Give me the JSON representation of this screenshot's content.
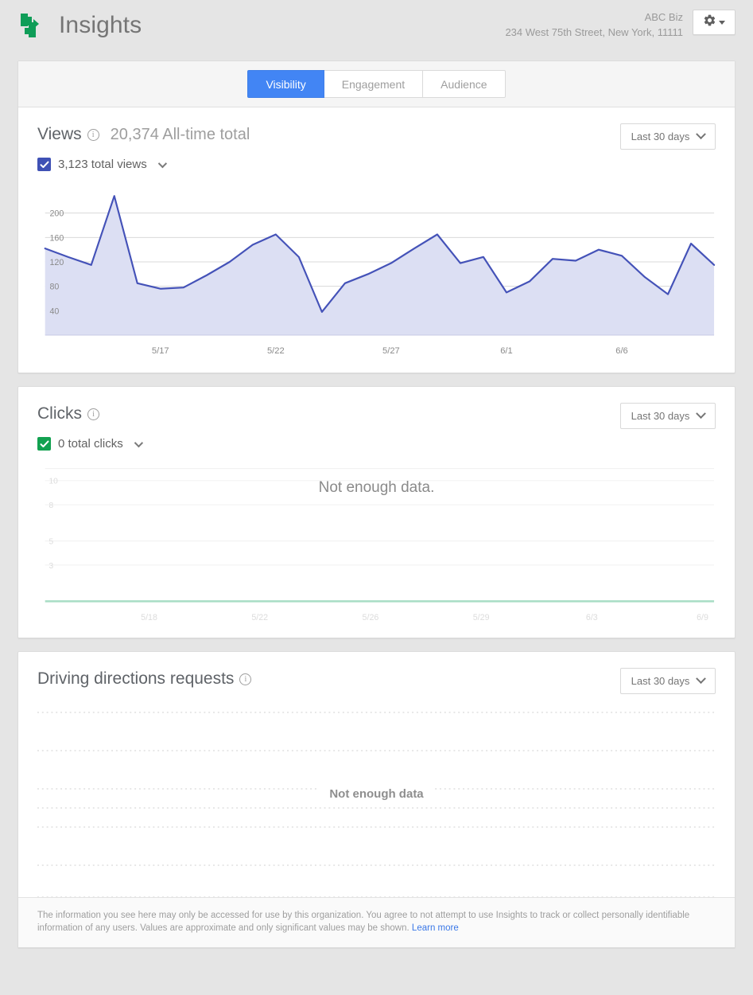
{
  "header": {
    "app_title": "Insights",
    "logo_icon": "insights-arrows-logo",
    "business_name": "ABC Biz",
    "business_address": "234 West 75th Street, New York, 11111",
    "settings_icon": "gear-icon"
  },
  "tabs": [
    {
      "label": "Visibility",
      "active": true
    },
    {
      "label": "Engagement",
      "active": false
    },
    {
      "label": "Audience",
      "active": false
    }
  ],
  "views": {
    "title": "Views",
    "info_icon": "info-icon",
    "subtitle": "20,374 All-time total",
    "range_label": "Last 30 days",
    "legend_label": "3,123 total views",
    "checkbox_color": "#3f51b5"
  },
  "clicks": {
    "title": "Clicks",
    "info_icon": "info-icon",
    "range_label": "Last 30 days",
    "legend_label": "0 total clicks",
    "checkbox_color": "#12a150",
    "empty_message": "Not enough data."
  },
  "driving": {
    "title": "Driving directions requests",
    "info_icon": "info-icon",
    "range_label": "Last 30 days",
    "empty_message": "Not enough data"
  },
  "footer": {
    "text": "The information you see here may only be accessed for use by this organization. You agree to not attempt to use Insights to track or collect personally identifiable information of any users. Values are approximate and only significant values may be shown.",
    "link_label": "Learn more"
  },
  "chart_data": [
    {
      "type": "area",
      "id": "views-chart",
      "title": "Views",
      "xlabel": "",
      "ylabel": "",
      "ylim": [
        0,
        240
      ],
      "yticks": [
        40,
        80,
        120,
        160,
        200
      ],
      "grid": true,
      "line_color": "#4452b8",
      "fill_color": "#dcdff3",
      "xtick_labels": [
        "5/17",
        "5/22",
        "5/27",
        "6/1",
        "6/6"
      ],
      "xtick_indices": [
        5,
        10,
        15,
        20,
        25
      ],
      "x": [
        "5/12",
        "5/13",
        "5/14",
        "5/15",
        "5/16",
        "5/17",
        "5/18",
        "5/19",
        "5/20",
        "5/21",
        "5/22",
        "5/23",
        "5/24",
        "5/25",
        "5/26",
        "5/27",
        "5/28",
        "5/29",
        "5/30",
        "5/31",
        "6/1",
        "6/2",
        "6/3",
        "6/4",
        "6/5",
        "6/6",
        "6/7",
        "6/8",
        "6/9",
        "6/10"
      ],
      "values": [
        142,
        128,
        115,
        228,
        85,
        76,
        78,
        98,
        120,
        148,
        165,
        128,
        38,
        85,
        100,
        118,
        142,
        165,
        118,
        128,
        70,
        88,
        125,
        122,
        140,
        130,
        95,
        67,
        150,
        115
      ]
    },
    {
      "type": "line",
      "id": "clicks-chart",
      "title": "Clicks",
      "ylim": [
        0,
        11
      ],
      "yticks": [
        3,
        5,
        8,
        10
      ],
      "grid": true,
      "line_color": "#a8ddc4",
      "xtick_labels": [
        "5/18",
        "5/22",
        "5/26",
        "5/29",
        "6/3",
        "6/9"
      ],
      "x": [
        "5/12",
        "5/13",
        "5/14",
        "5/15",
        "5/16",
        "5/17",
        "5/18",
        "5/19",
        "5/20",
        "5/21",
        "5/22",
        "5/23",
        "5/24",
        "5/25",
        "5/26",
        "5/27",
        "5/28",
        "5/29",
        "5/30",
        "5/31",
        "6/1",
        "6/2",
        "6/3",
        "6/4",
        "6/5",
        "6/6",
        "6/7",
        "6/8",
        "6/9",
        "6/10"
      ],
      "values": [
        0,
        0,
        0,
        0,
        0,
        0,
        0,
        0,
        0,
        0,
        0,
        0,
        0,
        0,
        0,
        0,
        0,
        0,
        0,
        0,
        0,
        0,
        0,
        0,
        0,
        0,
        0,
        0,
        0,
        0
      ]
    }
  ]
}
